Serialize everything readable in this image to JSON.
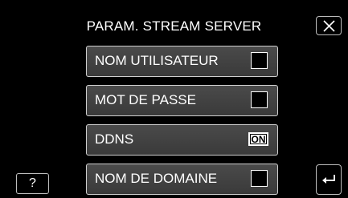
{
  "title": "PARAM. STREAM SERVER",
  "close_icon": "close-icon",
  "menu": [
    {
      "label": "NOM UTILISATEUR",
      "control": "checkbox"
    },
    {
      "label": "MOT DE PASSE",
      "control": "checkbox"
    },
    {
      "label": "DDNS",
      "control": "on-badge",
      "badge": "ON"
    },
    {
      "label": "NOM DE DOMAINE",
      "control": "checkbox"
    }
  ],
  "help_label": "?",
  "back_icon": "back-arrow-icon"
}
